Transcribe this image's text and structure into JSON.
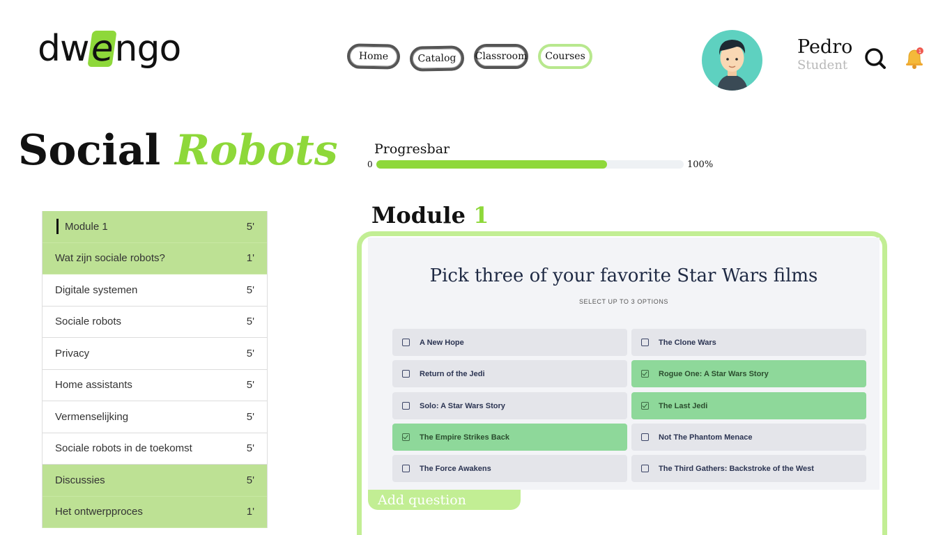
{
  "header": {
    "logo": {
      "pre": "dw",
      "highlight": "e",
      "post": "ngo"
    },
    "nav": [
      {
        "label": "Home"
      },
      {
        "label": "Catalog"
      },
      {
        "label": "Classroom"
      },
      {
        "label": "Courses"
      }
    ],
    "user": {
      "name": "Pedro",
      "role": "Student"
    },
    "notification_count": "1",
    "icons": {
      "search": "search-icon",
      "notifications": "bell-icon",
      "avatar": "avatar"
    }
  },
  "course": {
    "title_plain": "Social",
    "title_accent": "Robots"
  },
  "progress": {
    "label": "Progresbar",
    "min_label": "0",
    "max_label": "100%",
    "value_percent": 75
  },
  "sidebar": {
    "items": [
      {
        "label": "Module 1",
        "duration": "5'"
      },
      {
        "label": "Wat zijn sociale robots?",
        "duration": "1'"
      },
      {
        "label": "Digitale systemen",
        "duration": "5'"
      },
      {
        "label": "Sociale robots",
        "duration": "5'"
      },
      {
        "label": "Privacy",
        "duration": "5'"
      },
      {
        "label": "Home assistants",
        "duration": "5'"
      },
      {
        "label": "Vermenselijking",
        "duration": "5'"
      },
      {
        "label": "Sociale robots in de toekomst",
        "duration": "5'"
      },
      {
        "label": "Discussies",
        "duration": "5'"
      },
      {
        "label": "Het ontwerpproces",
        "duration": "1'"
      }
    ]
  },
  "module": {
    "title_word": "Module",
    "title_number": "1",
    "quiz": {
      "question": "Pick three of your favorite Star Wars films",
      "subtitle": "SELECT UP TO 3 OPTIONS",
      "options": [
        {
          "label": "A New Hope",
          "selected": false
        },
        {
          "label": "The Clone Wars",
          "selected": false
        },
        {
          "label": "Return of the Jedi",
          "selected": false
        },
        {
          "label": "Rogue One: A Star Wars Story",
          "selected": true
        },
        {
          "label": "Solo: A Star Wars Story",
          "selected": false
        },
        {
          "label": "The Last Jedi",
          "selected": true
        },
        {
          "label": "The Empire Strikes Back",
          "selected": true
        },
        {
          "label": "Not The Phantom Menace",
          "selected": false
        },
        {
          "label": "The Force Awakens",
          "selected": false
        },
        {
          "label": "The Third Gathers: Backstroke of the West",
          "selected": false
        }
      ]
    },
    "add_question_label": "Add question"
  },
  "colors": {
    "accent": "#8ed83a",
    "sidebar_highlight": "#bde194",
    "frame": "#c2ee94",
    "option_selected": "#8ed89a"
  }
}
